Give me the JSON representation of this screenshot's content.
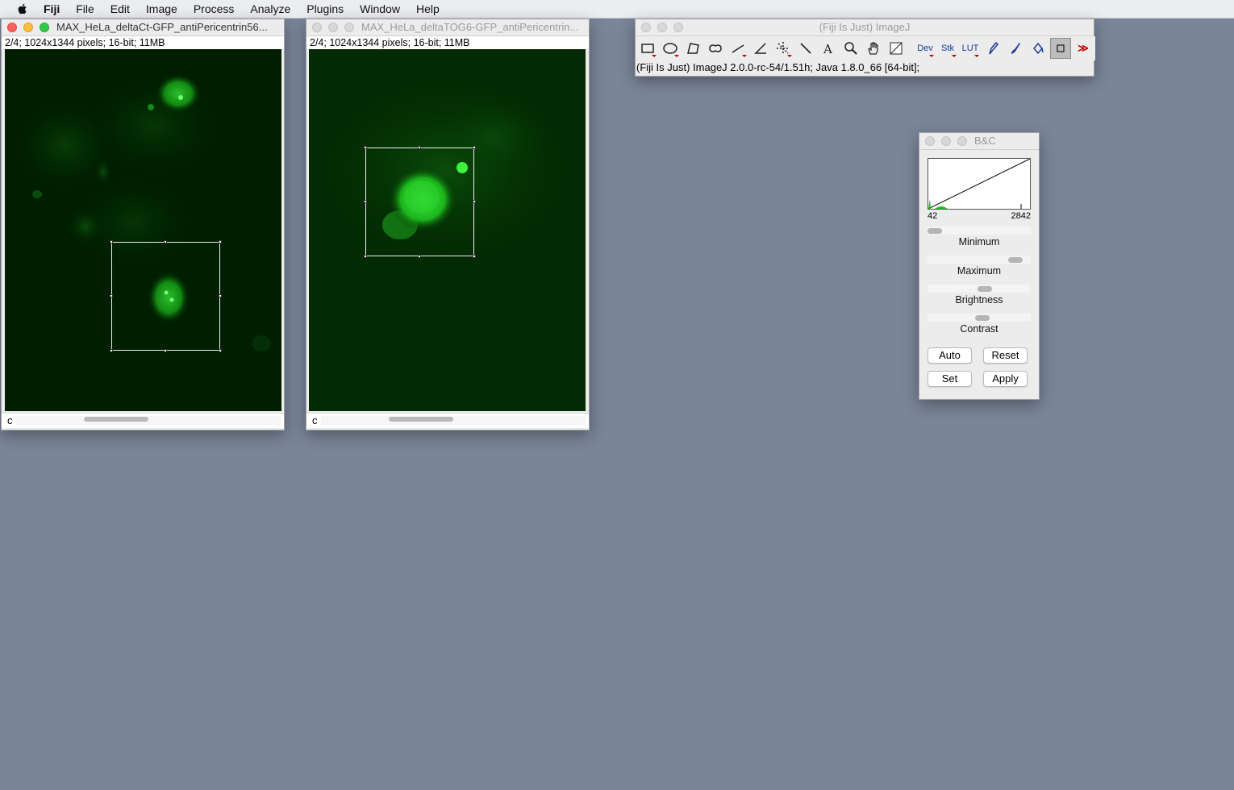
{
  "menubar": {
    "app": "Fiji",
    "items": [
      "File",
      "Edit",
      "Image",
      "Process",
      "Analyze",
      "Plugins",
      "Window",
      "Help"
    ]
  },
  "image_window_1": {
    "title": "MAX_HeLa_deltaCt-GFP_antiPericentrin56...",
    "info": "2/4; 1024x1344 pixels; 16-bit; 11MB",
    "channel_label": "c"
  },
  "image_window_2": {
    "title": "MAX_HeLa_deltaTOG6-GFP_antiPericentrin...",
    "info": "2/4; 1024x1344 pixels; 16-bit; 11MB",
    "channel_label": "c"
  },
  "imagej": {
    "title": "(Fiji Is Just) ImageJ",
    "status": "(Fiji Is Just) ImageJ 2.0.0-rc-54/1.51h; Java 1.8.0_66 [64-bit];",
    "tool_text": {
      "dev": "Dev",
      "stk": "Stk",
      "lut": "LUT",
      "more": "≫"
    }
  },
  "bc": {
    "title": "B&C",
    "hist_min": "42",
    "hist_max": "2842",
    "labels": {
      "minimum": "Minimum",
      "maximum": "Maximum",
      "brightness": "Brightness",
      "contrast": "Contrast"
    },
    "buttons": {
      "auto": "Auto",
      "reset": "Reset",
      "set": "Set",
      "apply": "Apply"
    },
    "colors": {
      "hist_peak": "#1fc41f"
    }
  },
  "colors": {
    "desktop": "#7a8598",
    "gfp": "#22dd22",
    "image_bg": "#001a00"
  }
}
